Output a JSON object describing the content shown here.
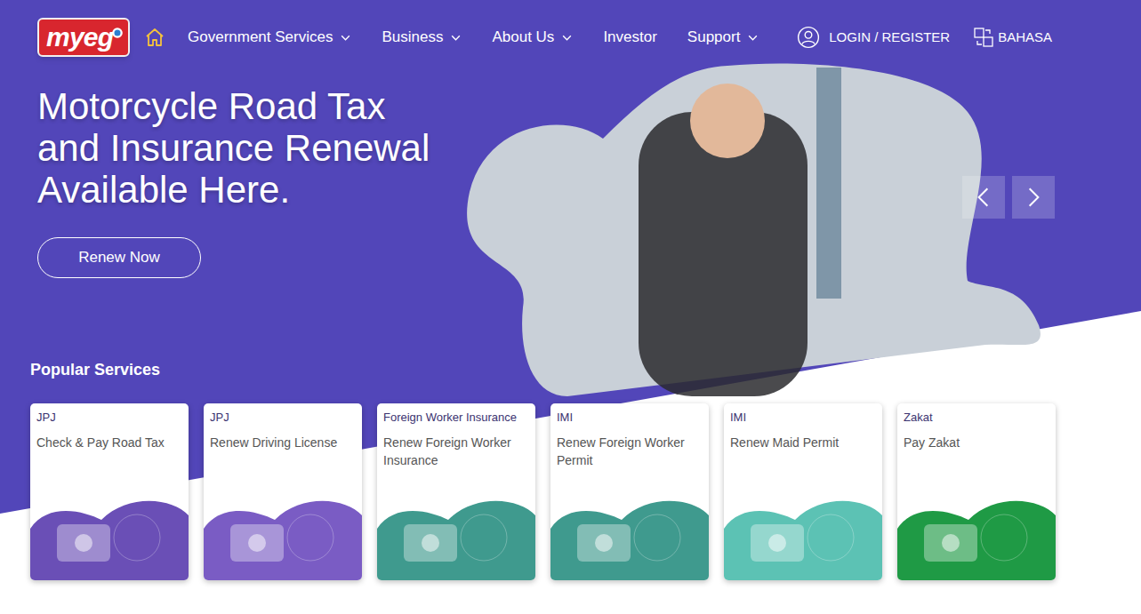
{
  "logo": {
    "text": "myeg"
  },
  "nav": {
    "items": [
      {
        "label": "Government Services",
        "dropdown": true
      },
      {
        "label": "Business",
        "dropdown": true
      },
      {
        "label": "About Us",
        "dropdown": true
      },
      {
        "label": "Investor",
        "dropdown": false
      },
      {
        "label": "Support",
        "dropdown": true
      }
    ],
    "login": "LOGIN / REGISTER",
    "language": "BAHASA"
  },
  "hero": {
    "title_lines": [
      "Motorcycle Road Tax",
      "and Insurance Renewal",
      "Available Here."
    ],
    "button": "Renew Now"
  },
  "popular": {
    "title": "Popular Services",
    "cards": [
      {
        "category": "JPJ",
        "title": "Check & Pay Road Tax",
        "color": "#6a4fb6"
      },
      {
        "category": "JPJ",
        "title": "Renew Driving License",
        "color": "#7a5cc4"
      },
      {
        "category": "Foreign Worker Insurance",
        "title": "Renew Foreign Worker Insurance",
        "color": "#3f9a8e"
      },
      {
        "category": "IMI",
        "title": "Renew Foreign Worker Permit",
        "color": "#3f9a8e"
      },
      {
        "category": "IMI",
        "title": "Renew Maid Permit",
        "color": "#5cc2b4"
      },
      {
        "category": "Zakat",
        "title": "Pay Zakat",
        "color": "#1f9a45"
      }
    ]
  }
}
